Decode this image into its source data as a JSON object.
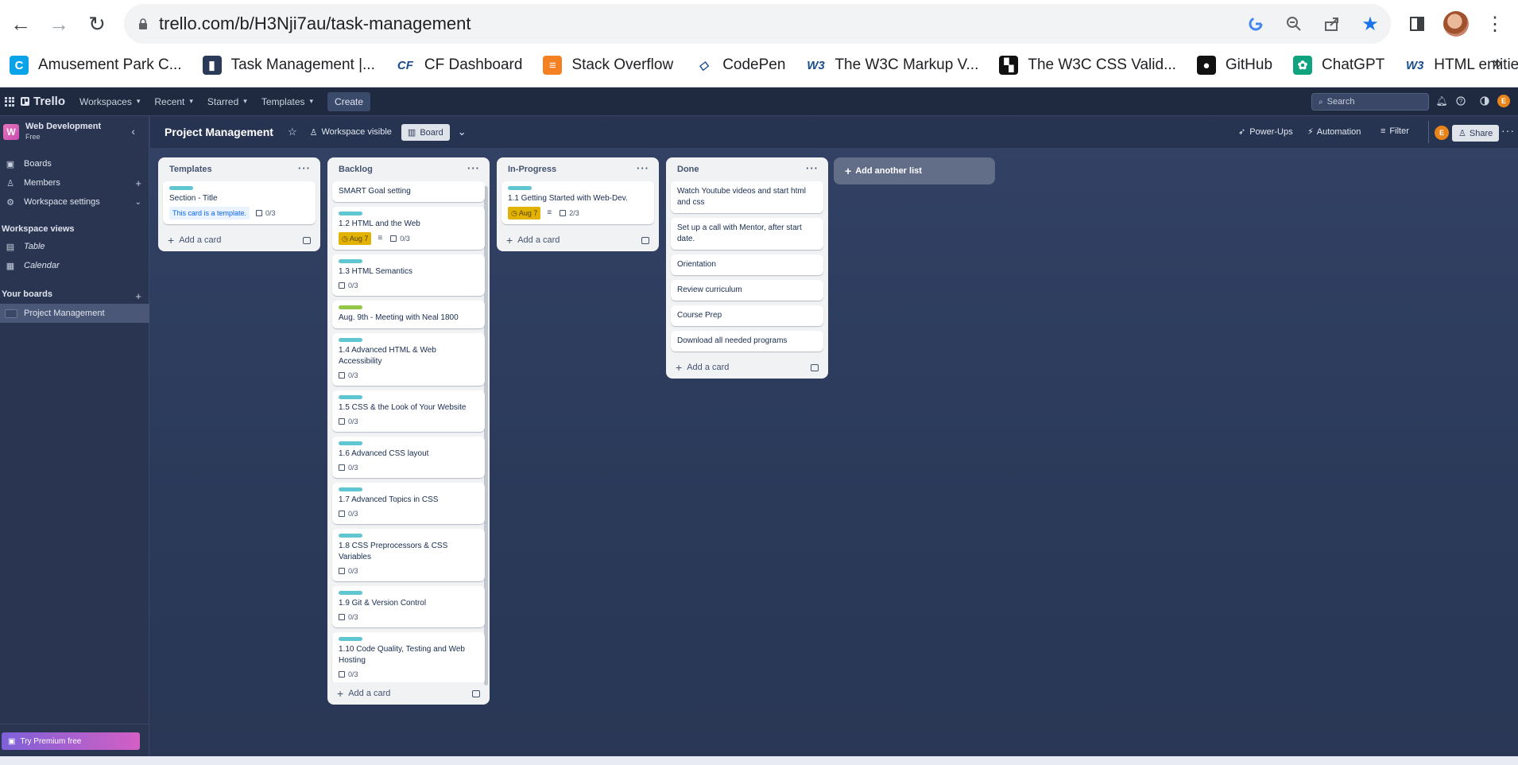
{
  "browser": {
    "url": "trello.com/b/H3Nji7au/task-management",
    "bookmarks": [
      {
        "label": "Amusement Park C...",
        "icon": "amusement-park-favicon",
        "color": "#0aa2e8",
        "glyph": "C"
      },
      {
        "label": "Task Management |...",
        "icon": "trello-favicon",
        "color": "#2b3a59",
        "glyph": "▮"
      },
      {
        "label": "CF Dashboard",
        "icon": "cf-favicon",
        "color": "#ffffff",
        "glyph": "CF"
      },
      {
        "label": "Stack Overflow",
        "icon": "stackoverflow-favicon",
        "color": "#f48024",
        "glyph": "≡"
      },
      {
        "label": "CodePen",
        "icon": "codepen-favicon",
        "color": "#ffffff",
        "glyph": "◇"
      },
      {
        "label": "The W3C Markup V...",
        "icon": "w3c-favicon",
        "color": "#ffffff",
        "glyph": "W3"
      },
      {
        "label": "The W3C CSS Valid...",
        "icon": "w3c-css-favicon",
        "color": "#111111",
        "glyph": "▚"
      },
      {
        "label": "GitHub",
        "icon": "github-favicon",
        "color": "#111111",
        "glyph": "●"
      },
      {
        "label": "ChatGPT",
        "icon": "chatgpt-favicon",
        "color": "#10a37f",
        "glyph": "✿"
      },
      {
        "label": "HTML entities",
        "icon": "w3-favicon",
        "color": "#ffffff",
        "glyph": "W3"
      }
    ],
    "more": "»"
  },
  "header": {
    "logo": "Trello",
    "menus": [
      "Workspaces",
      "Recent",
      "Starred",
      "Templates"
    ],
    "create": "Create",
    "search_placeholder": "Search",
    "avatar_initial": "E"
  },
  "sidebar": {
    "workspace_initial": "W",
    "workspace_name": "Web Development",
    "workspace_plan": "Free",
    "items": [
      {
        "label": "Boards",
        "icon": "boards-icon"
      },
      {
        "label": "Members",
        "icon": "members-icon"
      },
      {
        "label": "Workspace settings",
        "icon": "settings-icon"
      }
    ],
    "views_heading": "Workspace views",
    "views": [
      {
        "label": "Table",
        "icon": "table-icon"
      },
      {
        "label": "Calendar",
        "icon": "calendar-icon"
      }
    ],
    "boards_heading": "Your boards",
    "boards": [
      "Project Management"
    ],
    "premium": "Try Premium free"
  },
  "board": {
    "title": "Project Management",
    "visibility": "Workspace visible",
    "view": "Board",
    "powerups": "Power-Ups",
    "automation": "Automation",
    "filter": "Filter",
    "share": "Share",
    "add_list": "Add another list",
    "add_card": "Add a card",
    "lists": [
      {
        "title": "Templates",
        "cards": [
          {
            "title": "Section - Title",
            "label": "teal",
            "template": "This card is a template.",
            "check": "0/3"
          }
        ]
      },
      {
        "title": "Backlog",
        "cards": [
          {
            "title": "SMART Goal setting"
          },
          {
            "title": "1.2 HTML and the Web",
            "label": "teal",
            "date": "Aug 7",
            "desc": true,
            "check": "0/3"
          },
          {
            "title": "1.3 HTML Semantics",
            "label": "teal",
            "check": "0/3"
          },
          {
            "title": "Aug. 9th - Meeting with Neal 1800",
            "label": "green"
          },
          {
            "title": "1.4 Advanced HTML & Web Accessibility",
            "label": "teal",
            "check": "0/3"
          },
          {
            "title": "1.5 CSS & the Look of Your Website",
            "label": "teal",
            "check": "0/3"
          },
          {
            "title": "1.6 Advanced CSS layout",
            "label": "teal",
            "check": "0/3"
          },
          {
            "title": "1.7 Advanced Topics in CSS",
            "label": "teal",
            "check": "0/3"
          },
          {
            "title": "1.8 CSS Preprocessors & CSS Variables",
            "label": "teal",
            "check": "0/3"
          },
          {
            "title": "1.9 Git & Version Control",
            "label": "teal",
            "check": "0/3"
          },
          {
            "title": "1.10 Code Quality, Testing and Web Hosting",
            "label": "teal",
            "check": "0/3"
          }
        ]
      },
      {
        "title": "In-Progress",
        "cards": [
          {
            "title": "1.1 Getting Started with Web-Dev.",
            "label": "teal",
            "date": "Aug 7",
            "desc": true,
            "check": "2/3"
          }
        ]
      },
      {
        "title": "Done",
        "cards": [
          {
            "title": "Watch Youtube videos and start html and css"
          },
          {
            "title": "Set up a call with Mentor, after start date."
          },
          {
            "title": "Orientation"
          },
          {
            "title": "Review curriculum"
          },
          {
            "title": "Course Prep"
          },
          {
            "title": "Download all needed programs"
          }
        ]
      }
    ]
  }
}
